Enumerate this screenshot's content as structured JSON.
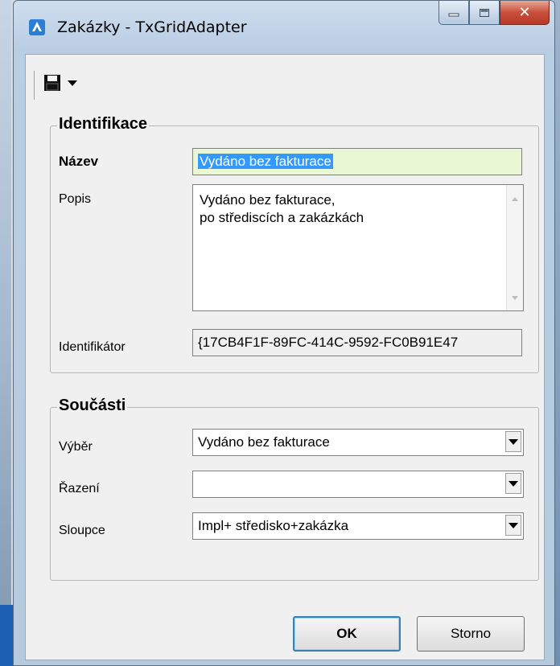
{
  "window": {
    "title": "Zakázky - TxGridAdapter"
  },
  "toolbar": {
    "save_icon": "floppy-disk-icon",
    "menu_icon": "chevron-down-icon"
  },
  "identifikace": {
    "title": "Identifikace",
    "nazev_label": "Název",
    "nazev_value": "Vydáno bez fakturace",
    "popis_label": "Popis",
    "popis_line1": "Vydáno bez fakturace,",
    "popis_line2": "po střediscích a zakázkách",
    "id_label": "Identifikátor",
    "id_value": "{17CB4F1F-89FC-414C-9592-FC0B91E47"
  },
  "soucasti": {
    "title": "Součásti",
    "vyber_label": "Výběr",
    "vyber_value": "Vydáno bez fakturace",
    "razeni_label": "Řazení",
    "razeni_value": "",
    "sloupce_label": "Sloupce",
    "sloupce_value": "Impl+ středisko+zakázka"
  },
  "buttons": {
    "ok": "OK",
    "cancel": "Storno"
  },
  "colors": {
    "selection": "#3399ff",
    "name_field_bg": "#eaf7d4",
    "close_button": "#c84f3a"
  }
}
